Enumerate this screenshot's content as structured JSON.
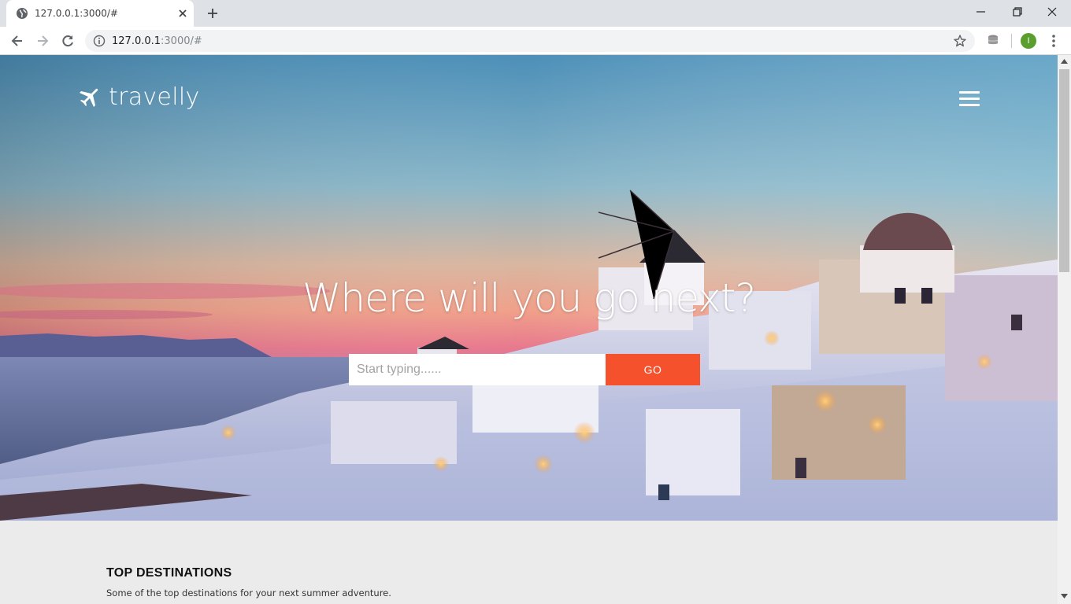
{
  "browser": {
    "tab_title": "127.0.0.1:3000/#",
    "url_host": "127.0.0.1",
    "url_rest": ":3000/#",
    "profile_initial": "I",
    "icons": {
      "tab_favicon": "globe-icon",
      "tab_close": "close-icon",
      "new_tab": "plus-icon",
      "back": "back-arrow-icon",
      "forward": "forward-arrow-icon",
      "reload": "reload-icon",
      "site_info": "info-icon",
      "bookmark": "star-icon",
      "extension": "database-icon",
      "menu": "kebab-menu-icon"
    }
  },
  "nav": {
    "brand": "travelly",
    "brand_icon": "airplane-icon",
    "menu_icon": "hamburger-icon"
  },
  "hero": {
    "headline": "Where will you go next?",
    "search_placeholder": "Start typing......",
    "go_label": "GO"
  },
  "top_destinations": {
    "title": "TOP DESTINATIONS",
    "subtitle": "Some of the top destinations for your next summer adventure."
  },
  "colors": {
    "accent": "#f4512c",
    "page_bg": "#ebebeb"
  }
}
